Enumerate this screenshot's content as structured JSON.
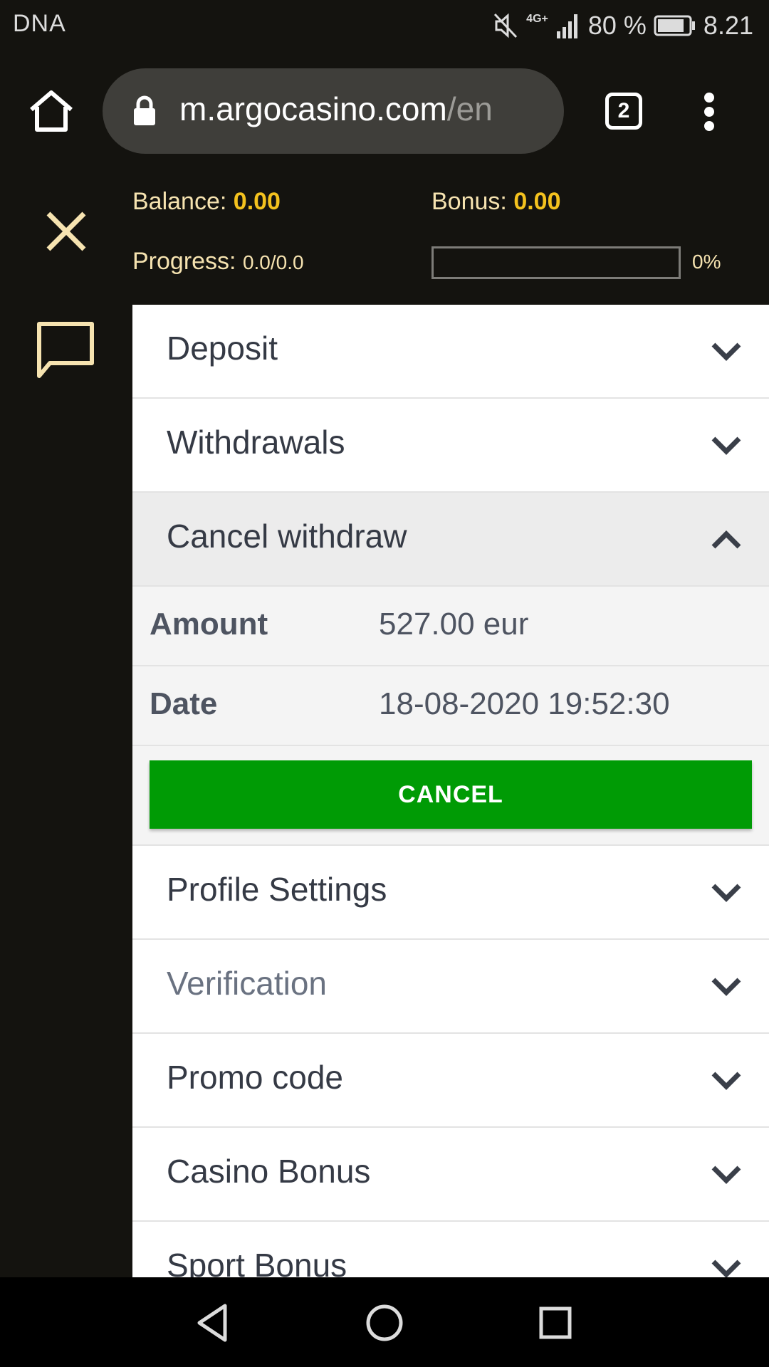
{
  "status_bar": {
    "carrier": "DNA",
    "network": "4G+",
    "battery": "80 %",
    "time": "8.21"
  },
  "browser": {
    "url_host": "m.argocasino.com",
    "url_path": "/en",
    "tab_count": "2"
  },
  "account": {
    "balance_label": "Balance:",
    "balance_value": "0.00",
    "bonus_label": "Bonus:",
    "bonus_value": "0.00",
    "progress_label": "Progress:",
    "progress_value": "0.0/0.0",
    "progress_percent": "0%",
    "progress_fraction": 0
  },
  "menu": {
    "deposit": "Deposit",
    "withdrawals": "Withdrawals",
    "cancel_withdraw": "Cancel withdraw",
    "profile_settings": "Profile Settings",
    "verification": "Verification",
    "promo_code": "Promo code",
    "casino_bonus": "Casino Bonus",
    "sport_bonus": "Sport Bonus"
  },
  "withdraw": {
    "amount_label": "Amount",
    "amount_value": "527.00 eur",
    "date_label": "Date",
    "date_value": "18-08-2020 19:52:30",
    "cancel_button": "CANCEL"
  },
  "colors": {
    "accent_gold": "#f4c21e",
    "cancel_green": "#009b05",
    "dark_bg": "#14130f"
  }
}
